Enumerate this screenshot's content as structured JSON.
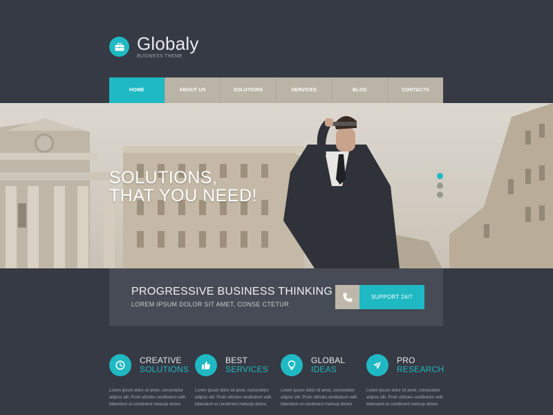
{
  "header": {
    "logo_title": "Globaly",
    "logo_subtitle": "BUSINESS THEME",
    "logo_icon": "briefcase-icon"
  },
  "nav": {
    "items": [
      "HOME",
      "ABOUT US",
      "SOLUTIONS",
      "SERVICES",
      "BLOG",
      "CONTACTS"
    ],
    "active": "HOME"
  },
  "hero": {
    "line1": "SOLUTIONS,",
    "line2": "THAT YOU NEED!",
    "slides": 3,
    "active_slide": 1
  },
  "band": {
    "title": "PROGRESSIVE BUSINESS THINKING",
    "subtitle": "LOREM IPSUM DOLOR SIT AMET, CONSE CTETUR",
    "button_label": "SUPPORT 24/7",
    "button_icon": "phone-icon"
  },
  "features": [
    {
      "icon": "clock-icon",
      "title1": "CREATIVE",
      "title2": "SOLUTIONS",
      "text": [
        "Lorem ipsum dolor sit amet, consectetur",
        "adipisc elit. Proin ultricies vestibulum velit.",
        "bibendum et condiment metusip dolore"
      ]
    },
    {
      "icon": "thumbs-up-icon",
      "title1": "BEST",
      "title2": "SERVICES",
      "text": [
        "Lorem ipsum dolor sit amet, consectetur",
        "adipisc elit. Proin ultricies vestibulum velit.",
        "bibendum et condiment metusip dolore"
      ]
    },
    {
      "icon": "lightbulb-icon",
      "title1": "GLOBAL",
      "title2": "IDEAS",
      "text": [
        "Lorem ipsum dolor sit amet, consectetur",
        "adipisc elit. Proin ultricies vestibulum velit.",
        "bibendum et condiment metusip dolore"
      ]
    },
    {
      "icon": "paper-plane-icon",
      "title1": "PRO",
      "title2": "RESEARCH",
      "text": [
        "Lorem ipsum dolor sit amet, consectetur",
        "adipisc elit. Proin ultricies vestibulum velit.",
        "bibendum et condiment metusip dolore"
      ]
    }
  ],
  "colors": {
    "background": "#363a44",
    "accent": "#1fb9c3",
    "nav_bg": "#b9b4a6",
    "band_bg": "#474b55"
  }
}
